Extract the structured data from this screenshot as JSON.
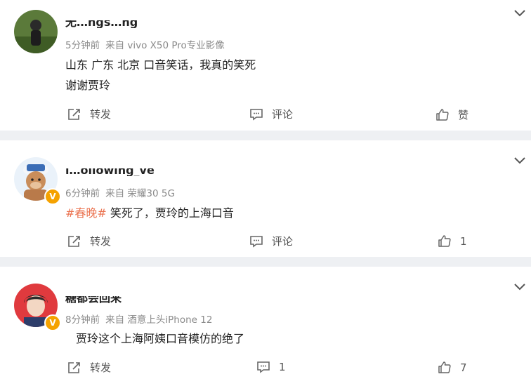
{
  "posts": [
    {
      "username": "无…ngs…ng",
      "time": "5分钟前",
      "source": "来自 vivo X50 Pro专业影像",
      "lines": [
        "山东 广东 北京 口音笑话，我真的笑死",
        "谢谢贾玲"
      ],
      "topic": "",
      "verified": false,
      "actions": {
        "repost": "转发",
        "comment": "评论",
        "like": "赞"
      }
    },
    {
      "username": "l…ollowing_ve",
      "time": "6分钟前",
      "source": "来自 荣耀30 5G",
      "topic": "#春晚#",
      "lines": [
        "笑死了，贾玲的上海口音"
      ],
      "verified": true,
      "actions": {
        "repost": "转发",
        "comment": "评论",
        "like": "1"
      }
    },
    {
      "username": "糖都会回来",
      "time": "8分钟前",
      "source": "来自 酒意上头iPhone 12",
      "topic": "",
      "lines": [
        "贾玲这个上海阿姨口音模仿的绝了"
      ],
      "verified": true,
      "actions": {
        "repost": "转发",
        "comment": "1",
        "like": "7"
      }
    }
  ],
  "colors": {
    "topic": "#eb7350",
    "badge": "#f5a200",
    "separator": "#eef0f3"
  },
  "icons": [
    "chevron-down-icon",
    "repost-icon",
    "comment-icon",
    "like-icon",
    "verified-badge-icon"
  ]
}
